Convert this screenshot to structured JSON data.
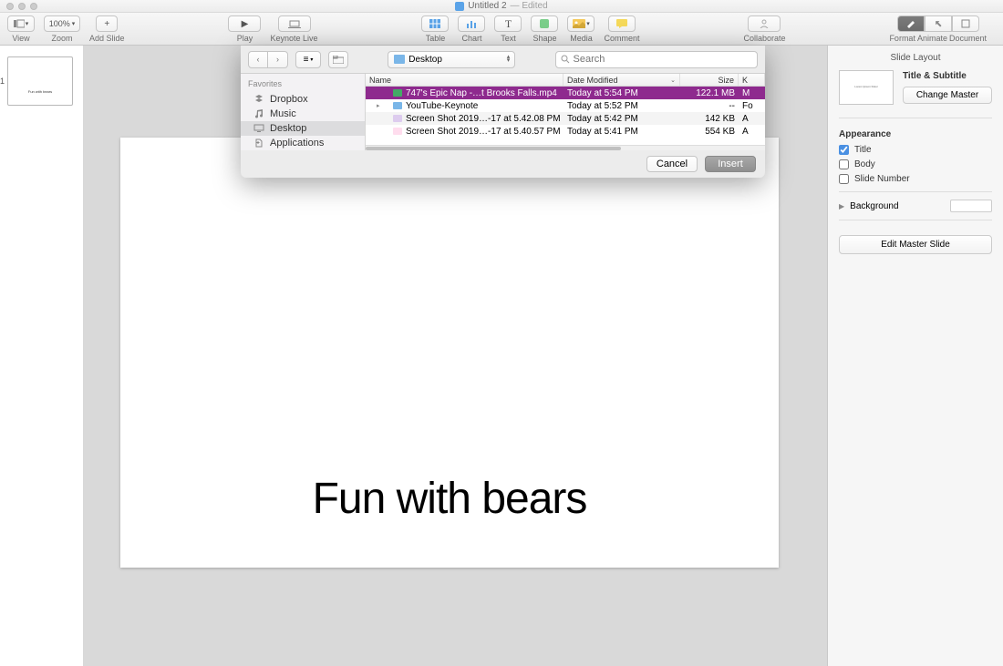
{
  "window": {
    "title": "Untitled 2",
    "edited": "— Edited"
  },
  "toolbar": {
    "view": "View",
    "zoom": "Zoom",
    "zoom_val": "100%",
    "add_slide": "Add Slide",
    "play": "Play",
    "keynote_live": "Keynote Live",
    "table": "Table",
    "chart": "Chart",
    "text": "Text",
    "shape": "Shape",
    "media": "Media",
    "comment": "Comment",
    "collaborate": "Collaborate",
    "format": "Format",
    "animate": "Animate",
    "document": "Document"
  },
  "thumbnail": {
    "num": "1",
    "text": "Fun with bears"
  },
  "slide": {
    "title": "Fun with bears"
  },
  "inspector": {
    "header": "Slide Layout",
    "master_label": "Lorem Ipsum Dolor",
    "master_title": "Title & Subtitle",
    "change_master": "Change Master",
    "appearance": "Appearance",
    "title_cb": "Title",
    "body_cb": "Body",
    "slidenum_cb": "Slide Number",
    "background": "Background",
    "edit_master": "Edit Master Slide"
  },
  "dialog": {
    "location": "Desktop",
    "search_placeholder": "Search",
    "sidebar_header": "Favorites",
    "sidebar": [
      {
        "label": "Dropbox",
        "icon": "dropbox"
      },
      {
        "label": "Music",
        "icon": "music"
      },
      {
        "label": "Desktop",
        "icon": "desktop",
        "selected": true
      },
      {
        "label": "Applications",
        "icon": "apps"
      }
    ],
    "columns": {
      "name": "Name",
      "date": "Date Modified",
      "size": "Size",
      "kind": "K"
    },
    "files": [
      {
        "name": "747's Epic Nap -…t Brooks Falls.mp4",
        "date": "Today at 5:54 PM",
        "size": "122.1 MB",
        "kind": "M",
        "icon": "#4a6",
        "selected": true
      },
      {
        "name": "YouTube-Keynote",
        "date": "Today at 5:52 PM",
        "size": "--",
        "kind": "Fo",
        "icon": "#7ab6e8",
        "expandable": true
      },
      {
        "name": "Screen Shot 2019…-17 at 5.42.08 PM",
        "date": "Today at 5:42 PM",
        "size": "142 KB",
        "kind": "A",
        "icon": "#dce"
      },
      {
        "name": "Screen Shot 2019…-17 at 5.40.57 PM",
        "date": "Today at 5:41 PM",
        "size": "554 KB",
        "kind": "A",
        "icon": "#fde"
      }
    ],
    "cancel": "Cancel",
    "insert": "Insert"
  }
}
